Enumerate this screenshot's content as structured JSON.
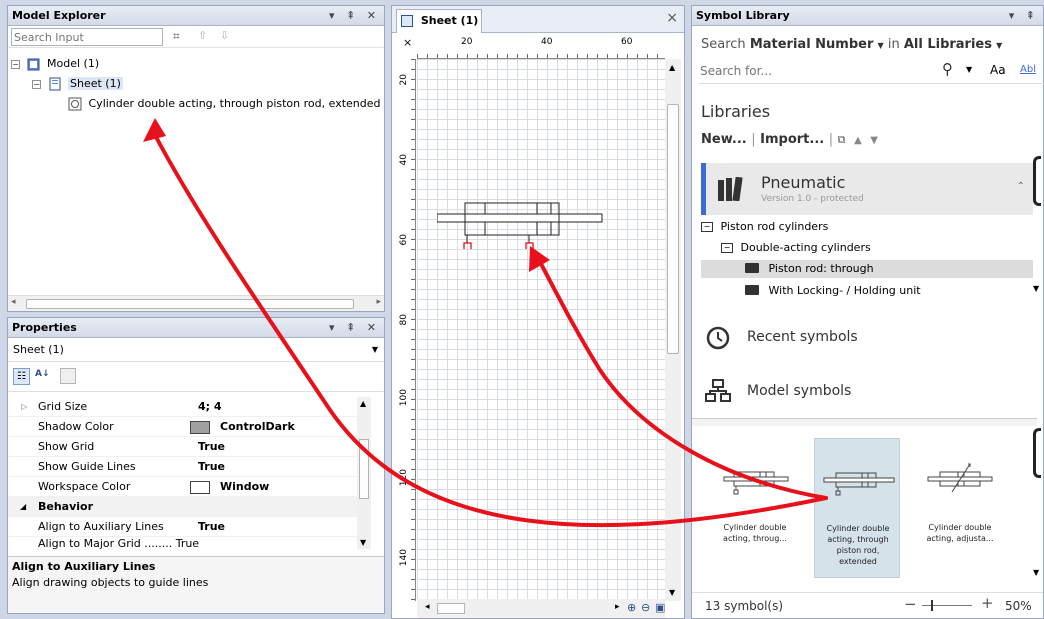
{
  "model_explorer": {
    "title": "Model Explorer",
    "title_icons": "▾ ⇞ ✕",
    "search_placeholder": "Search Input",
    "tree": [
      {
        "label": "Model (1)"
      },
      {
        "label": "Sheet (1)"
      },
      {
        "label": "Cylinder double acting, through piston rod, extended"
      }
    ]
  },
  "properties": {
    "title": "Properties",
    "title_icons": "▾ ⇞ ✕",
    "selected_object": "Sheet (1)",
    "rows": [
      {
        "name": "Grid Size",
        "value": "4; 4"
      },
      {
        "name": "Shadow Color",
        "value": "ControlDark",
        "swatch": "#a0a0a0"
      },
      {
        "name": "Show Grid",
        "value": "True"
      },
      {
        "name": "Show Guide Lines",
        "value": "True"
      },
      {
        "name": "Workspace Color",
        "value": "Window",
        "swatch": "#ffffff"
      }
    ],
    "category_behavior": "Behavior",
    "behavior_rows": [
      {
        "name": "Align to Auxiliary Lines",
        "value": "True"
      }
    ],
    "description_title": "Align to Auxiliary Lines",
    "description_text": "Align drawing objects to guide lines"
  },
  "sheet": {
    "tab_label": "Sheet (1)",
    "tab_close": "×",
    "close": "×",
    "ruler_top": [
      "20",
      "40",
      "60"
    ],
    "ruler_left": [
      "20",
      "40",
      "60",
      "80",
      "100",
      "120",
      "140"
    ]
  },
  "symbol_library": {
    "title": "Symbol Library",
    "title_icons": "▾ ⇞",
    "search_prefix": "Search",
    "search_field": "Material Number",
    "search_in": "in",
    "search_scope": "All Libraries",
    "search_placeholder": "Search for...",
    "aa_label": "Aa",
    "ab_label": "Abl",
    "libraries_heading": "Libraries",
    "new_label": "New...",
    "import_label": "Import...",
    "library_name": "Pneumatic",
    "library_version": "Version 1.0 - protected",
    "tree": [
      {
        "label": "Piston rod cylinders"
      },
      {
        "label": "Double-acting cylinders"
      },
      {
        "label": "Piston rod: through"
      },
      {
        "label": "With Locking- / Holding unit"
      }
    ],
    "recent_label": "Recent symbols",
    "model_label": "Model symbols",
    "symbols": [
      {
        "label": "Cylinder double acting, throug..."
      },
      {
        "label": "Cylinder double acting, through piston rod, extended"
      },
      {
        "label": "Cylinder double acting, adjusta..."
      }
    ],
    "count_label": "13 symbol(s)",
    "zoom_label": "50%"
  },
  "accent": "#3d6bd6",
  "arrow_color": "#e8101a"
}
